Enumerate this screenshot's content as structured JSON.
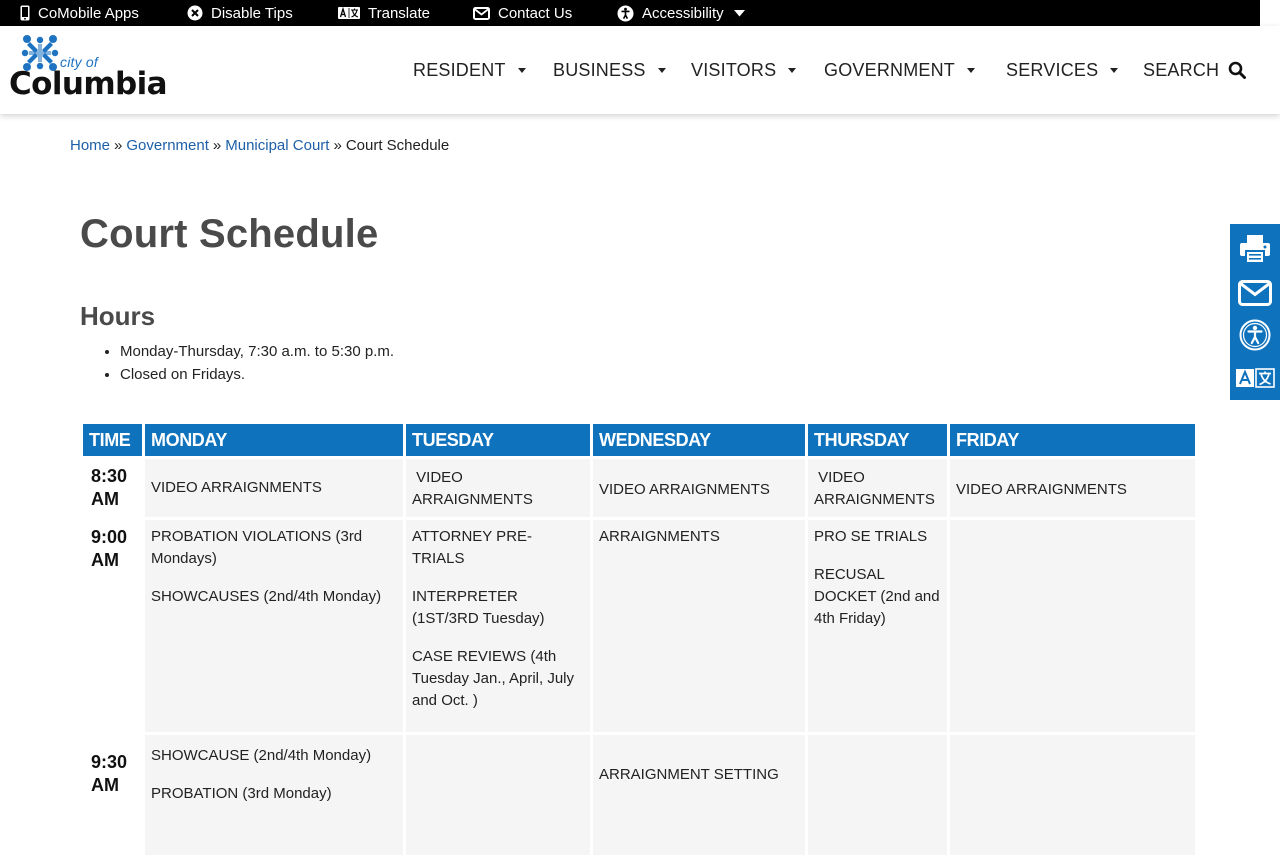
{
  "topbar": {
    "items": [
      {
        "label": "CoMobile Apps"
      },
      {
        "label": "Disable Tips"
      },
      {
        "label": "Translate"
      },
      {
        "label": "Contact Us"
      },
      {
        "label": "Accessibility"
      }
    ]
  },
  "logo": {
    "city_of": "city of",
    "name": "Columbia"
  },
  "nav": {
    "items": [
      {
        "label": "RESIDENT"
      },
      {
        "label": "BUSINESS"
      },
      {
        "label": "VISITORS"
      },
      {
        "label": "GOVERNMENT"
      },
      {
        "label": "SERVICES"
      }
    ],
    "search_label": "SEARCH"
  },
  "breadcrumb": {
    "links": [
      "Home",
      "Government",
      "Municipal Court"
    ],
    "separator": "»",
    "current": "Court Schedule"
  },
  "page": {
    "title": "Court Schedule",
    "hours_heading": "Hours",
    "hours": [
      "Monday-Thursday, 7:30 a.m. to 5:30 p.m.",
      "Closed on Fridays."
    ]
  },
  "schedule": {
    "headers": [
      "TIME",
      "MONDAY",
      "TUESDAY",
      "WEDNESDAY",
      "THURSDAY",
      "FRIDAY"
    ],
    "rows": [
      {
        "time": "8:30 AM",
        "cells": [
          [
            "VIDEO ARRAIGNMENTS"
          ],
          [
            " VIDEO ARRAIGNMENTS"
          ],
          [
            "VIDEO ARRAIGNMENTS"
          ],
          [
            " VIDEO ARRAIGNMENTS"
          ],
          [
            "VIDEO ARRAIGNMENTS"
          ]
        ]
      },
      {
        "time": "9:00 AM",
        "cells": [
          [
            "PROBATION VIOLATIONS (3rd Mondays)",
            "SHOWCAUSES (2nd/4th Monday)"
          ],
          [
            "ATTORNEY PRE-TRIALS",
            "INTERPRETER (1ST/3RD Tuesday)",
            "CASE REVIEWS (4th Tuesday Jan., April, July and Oct. )"
          ],
          [
            "ARRAIGNMENTS"
          ],
          [
            "PRO SE TRIALS",
            "RECUSAL DOCKET (2nd and 4th Friday)"
          ],
          []
        ]
      },
      {
        "time": "9:30 AM",
        "cells": [
          [
            "SHOWCAUSE (2nd/4th Monday)",
            "PROBATION (3rd Monday)"
          ],
          [],
          [
            "ARRAIGNMENT SETTING"
          ],
          [],
          []
        ]
      }
    ]
  },
  "colors": {
    "accent": "#0f72bd",
    "link": "#1d5fa8",
    "heading": "#4a4a4a"
  }
}
